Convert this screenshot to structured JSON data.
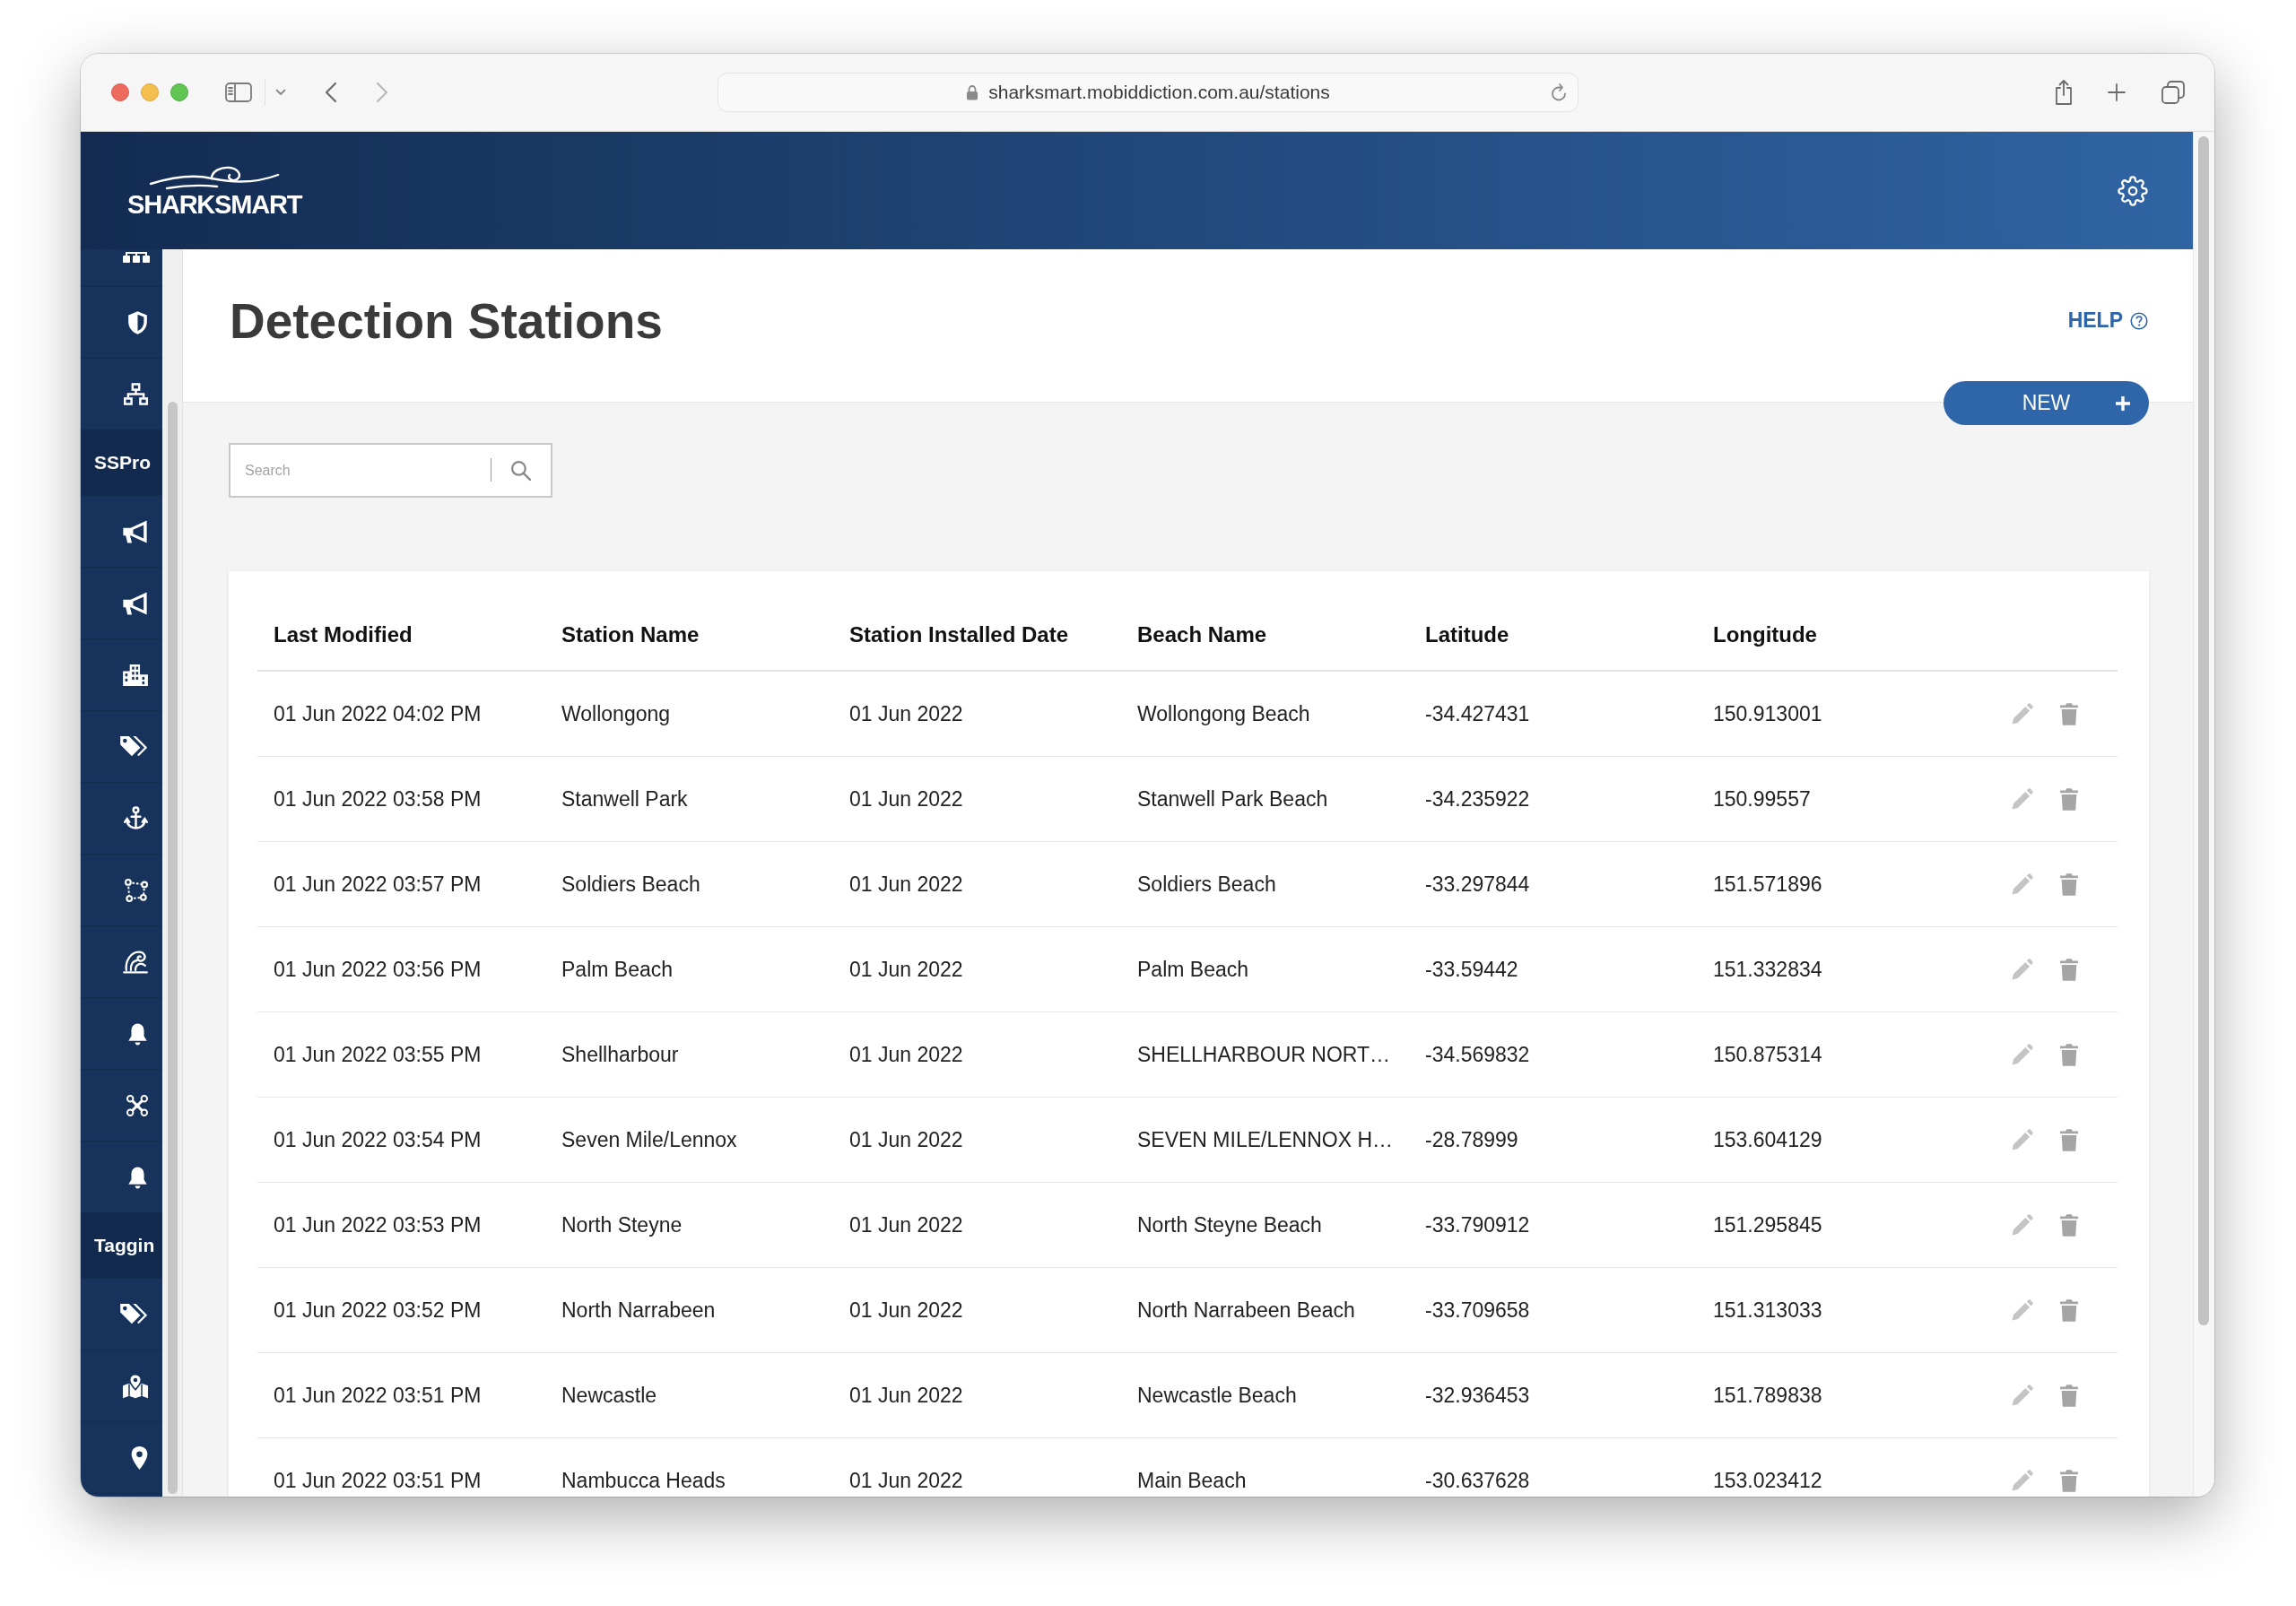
{
  "browser": {
    "nav": [
      {
        "kind": "back",
        "disabled": false
      },
      {
        "kind": "forward",
        "disabled": true
      }
    ],
    "url": "sharksmart.mobiddiction.com.au/stations"
  },
  "header": {
    "logo": "SHARKSMART"
  },
  "sidebar": {
    "items": [
      {
        "kind": "icon"
      },
      {
        "kind": "icon"
      },
      {
        "kind": "icon"
      },
      {
        "kind": "section",
        "label": "SSPro"
      },
      {
        "kind": "icon"
      },
      {
        "kind": "icon"
      },
      {
        "kind": "icon"
      },
      {
        "kind": "icon"
      },
      {
        "kind": "icon"
      },
      {
        "kind": "icon"
      },
      {
        "kind": "icon"
      },
      {
        "kind": "icon"
      },
      {
        "kind": "icon"
      },
      {
        "kind": "icon"
      },
      {
        "kind": "section",
        "label": "Taggin"
      },
      {
        "kind": "icon"
      },
      {
        "kind": "icon"
      },
      {
        "kind": "icon"
      }
    ]
  },
  "page": {
    "title": "Detection Stations",
    "help": "HELP",
    "new_button": "NEW",
    "search": {
      "placeholder": "Search"
    }
  },
  "table": {
    "columns": [
      "Last Modified",
      "Station Name",
      "Station Installed Date",
      "Beach Name",
      "Latitude",
      "Longitude"
    ],
    "rows": [
      [
        "01 Jun 2022 04:02 PM",
        "Wollongong",
        "01 Jun 2022",
        "Wollongong Beach",
        "-34.427431",
        "150.913001"
      ],
      [
        "01 Jun 2022 03:58 PM",
        "Stanwell Park",
        "01 Jun 2022",
        "Stanwell Park Beach",
        "-34.235922",
        "150.99557"
      ],
      [
        "01 Jun 2022 03:57 PM",
        "Soldiers Beach",
        "01 Jun 2022",
        "Soldiers Beach",
        "-33.297844",
        "151.571896"
      ],
      [
        "01 Jun 2022 03:56 PM",
        "Palm Beach",
        "01 Jun 2022",
        "Palm Beach",
        "-33.59442",
        "151.332834"
      ],
      [
        "01 Jun 2022 03:55 PM",
        "Shellharbour",
        "01 Jun 2022",
        "SHELLHARBOUR NORT…",
        "-34.569832",
        "150.875314"
      ],
      [
        "01 Jun 2022 03:54 PM",
        "Seven Mile/Lennox",
        "01 Jun 2022",
        "SEVEN MILE/LENNOX H…",
        "-28.78999",
        "153.604129"
      ],
      [
        "01 Jun 2022 03:53 PM",
        "North Steyne",
        "01 Jun 2022",
        "North Steyne Beach",
        "-33.790912",
        "151.295845"
      ],
      [
        "01 Jun 2022 03:52 PM",
        "North Narrabeen",
        "01 Jun 2022",
        "North Narrabeen Beach",
        "-33.709658",
        "151.313033"
      ],
      [
        "01 Jun 2022 03:51 PM",
        "Newcastle",
        "01 Jun 2022",
        "Newcastle Beach",
        "-32.936453",
        "151.789838"
      ],
      [
        "01 Jun 2022 03:51 PM",
        "Nambucca Heads",
        "01 Jun 2022",
        "Main Beach",
        "-30.637628",
        "153.023412"
      ]
    ]
  }
}
